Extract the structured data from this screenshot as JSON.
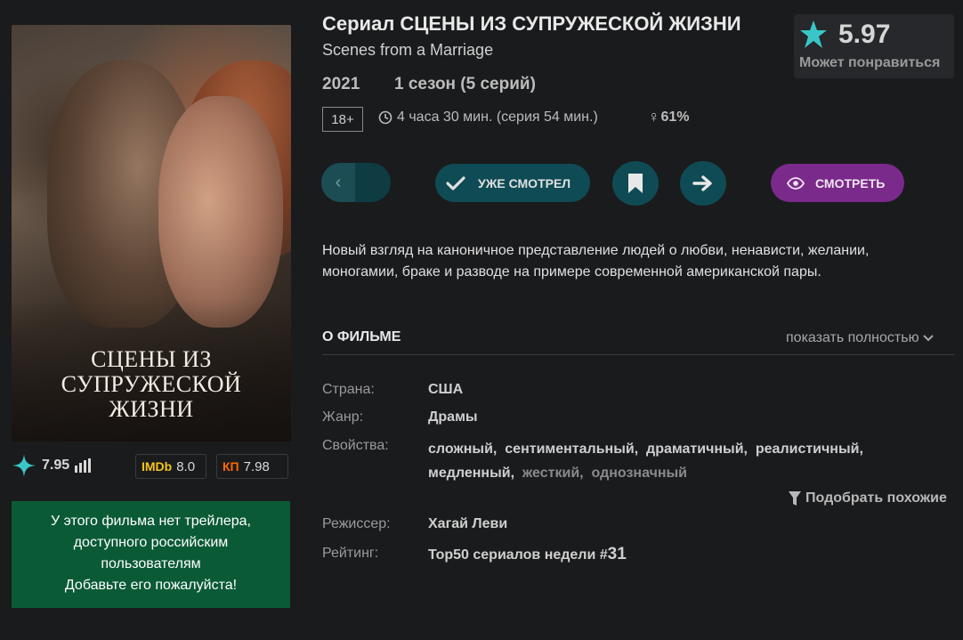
{
  "poster": {
    "title": "СЦЕНЫ ИЗ\nСУПРУЖЕСКОЙ\nЖИЗНИ"
  },
  "ratings": {
    "own": "7.95",
    "imdb_label": "IMDb",
    "imdb": "8.0",
    "kp_label": "КП",
    "kp": "7.98"
  },
  "trailer_note": "У этого фильма нет трейлера,\nдоступного российским\nпользователям\nДобавьте его пожалуйста!",
  "header": {
    "title": "Сериал СЦЕНЫ ИЗ СУПРУЖЕСКОЙ ЖИЗНИ",
    "original_title": "Scenes from a Marriage",
    "year": "2021",
    "season": "1 сезон (5 серий)",
    "age": "18+",
    "duration": "4 часа 30 мин. (серия 54 мин.)",
    "female_symbol": "♀",
    "female_pct": "61%"
  },
  "score": {
    "value": "5.97",
    "label": "Может понравиться"
  },
  "buttons": {
    "watched": "УЖЕ СМОТРЕЛ",
    "watch": "СМОТРЕТЬ"
  },
  "description": "Новый взгляд на каноничное представление людей о любви, ненависти, желании, моногамии, браке и разводе на примере современной американской пары.",
  "about": {
    "heading": "О ФИЛЬМЕ",
    "show_full": "показать полностью",
    "country_label": "Страна:",
    "country": "США",
    "genre_label": "Жанр:",
    "genre": "Драмы",
    "props_label": "Свойства:",
    "props": [
      "сложный",
      "сентиментальный",
      "драматичный",
      "реалистичный",
      "медленный",
      "жесткий",
      "однозначный"
    ],
    "similar": "Подобрать похожие",
    "director_label": "Режиссер:",
    "director": "Хагай Леви",
    "rating_label": "Рейтинг:",
    "rating_text": "Top50 сериалов недели #",
    "rating_num": "31"
  },
  "colors": {
    "accent_teal": "#0f4b54",
    "watch_purple": "#7a2a8a",
    "trailer_green": "#0a5a36",
    "star_teal": "#3ac6c6"
  }
}
